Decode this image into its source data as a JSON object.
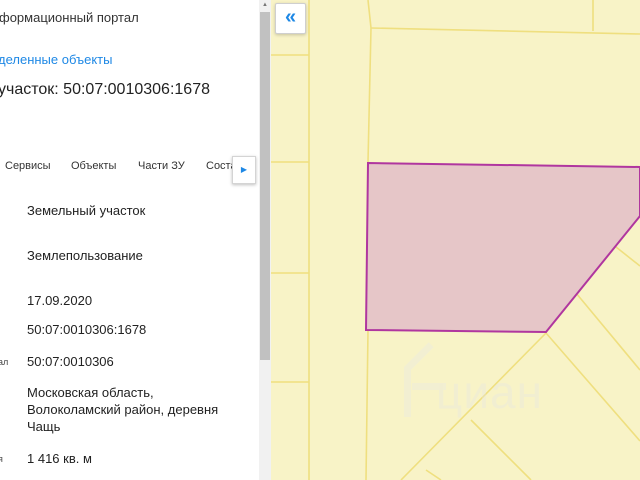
{
  "header": {
    "portal_title": "формационный портал",
    "selected_objects_link": "деленные объекты",
    "parcel_title": "участок: 50:07:0010306:1678"
  },
  "tabs": [
    {
      "label": "Сервисы"
    },
    {
      "label": "Объекты"
    },
    {
      "label": "Части ЗУ"
    },
    {
      "label": "Соста"
    }
  ],
  "tab_scroll_icon": "caret-right-icon",
  "details": {
    "type": "Земельный участок",
    "category": "Землепользование",
    "date": "17.09.2020",
    "cadastral_number": "50:07:0010306:1678",
    "quarter_label": "ал",
    "quarter": "50:07:0010306",
    "address_line1": "Московская область,",
    "address_line2": "Волоколамский район, деревня",
    "address_line3": "Чащь",
    "area_label": "я",
    "area": "1 416 кв. м"
  },
  "map": {
    "collapse_icon": "double-chevron-left-icon",
    "background_color": "#f8f3c7",
    "boundary_color": "#efdf7f",
    "parcel_fill": "#e6c6c8",
    "parcel_stroke": "#b0369f",
    "watermark": "циан"
  }
}
